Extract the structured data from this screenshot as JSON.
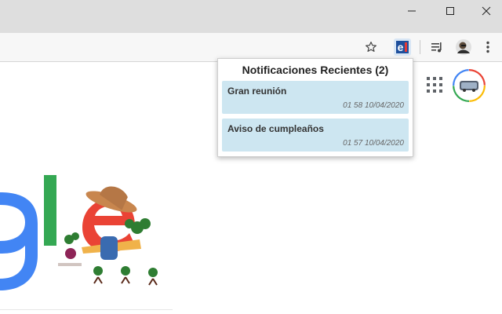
{
  "popup": {
    "title": "Notificaciones Recientes (2)",
    "notifications": [
      {
        "title": "Gran reunión",
        "time": "01 58 10/04/2020"
      },
      {
        "title": "Aviso de cumpleaños",
        "time": "01 57 10/04/2020"
      }
    ]
  },
  "colors": {
    "titlebar": "#dedede",
    "toolbar": "#f7f7f7",
    "notification_bg": "#cde6f1",
    "google_blue": "#4285f4",
    "google_green": "#34a853",
    "google_red": "#ea4335"
  },
  "toolbar_icons": [
    "star-icon",
    "extension-e-icon",
    "media-control-icon",
    "profile-avatar-icon",
    "menu-dots-icon"
  ],
  "window_controls": [
    "minimize-icon",
    "maximize-icon",
    "close-icon"
  ]
}
